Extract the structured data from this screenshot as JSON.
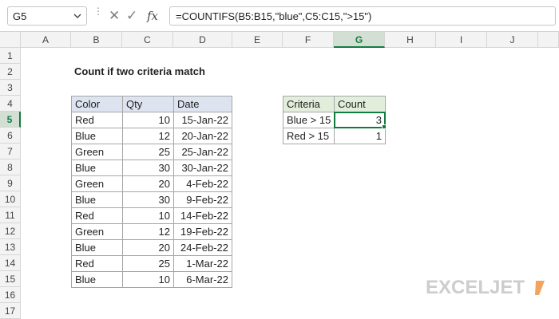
{
  "formula_bar": {
    "name_box": "G5",
    "name_box_chevron": "chevron-down-icon",
    "cancel_icon": "✕",
    "enter_icon": "✓",
    "fx_label": "fx",
    "formula": "=COUNTIFS(B5:B15,\"blue\",C5:C15,\">15\")"
  },
  "columns": [
    "A",
    "B",
    "C",
    "D",
    "E",
    "F",
    "G",
    "H",
    "I",
    "J"
  ],
  "selected_column": "G",
  "rows": [
    "1",
    "2",
    "3",
    "4",
    "5",
    "6",
    "7",
    "8",
    "9",
    "10",
    "11",
    "12",
    "13",
    "14",
    "15",
    "16",
    "17"
  ],
  "selected_row": "5",
  "sheet": {
    "title": "Count if two criteria match",
    "data_table": {
      "headers": [
        "Color",
        "Qty",
        "Date"
      ],
      "rows": [
        [
          "Red",
          "10",
          "15-Jan-22"
        ],
        [
          "Blue",
          "12",
          "20-Jan-22"
        ],
        [
          "Green",
          "25",
          "25-Jan-22"
        ],
        [
          "Blue",
          "30",
          "30-Jan-22"
        ],
        [
          "Green",
          "20",
          "4-Feb-22"
        ],
        [
          "Blue",
          "30",
          "9-Feb-22"
        ],
        [
          "Red",
          "10",
          "14-Feb-22"
        ],
        [
          "Green",
          "12",
          "19-Feb-22"
        ],
        [
          "Blue",
          "20",
          "24-Feb-22"
        ],
        [
          "Red",
          "25",
          "1-Mar-22"
        ],
        [
          "Blue",
          "10",
          "6-Mar-22"
        ]
      ]
    },
    "summary_table": {
      "headers": [
        "Criteria",
        "Count"
      ],
      "rows": [
        [
          "Blue > 15",
          "3"
        ],
        [
          "Red > 15",
          "1"
        ]
      ]
    }
  },
  "watermark": "EXCELJET",
  "colors": {
    "accent": "#107c41",
    "data_header_fill": "#dde4f0",
    "summary_header_fill": "#e2eedb",
    "logo": "#cdcdcd",
    "logo_mark": "#f2a35e"
  }
}
